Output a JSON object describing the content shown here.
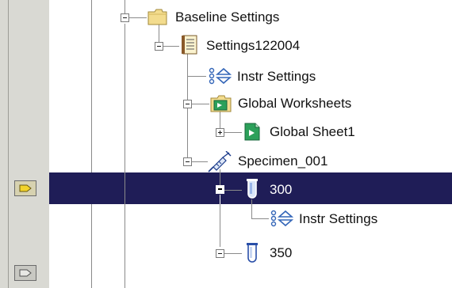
{
  "tree": {
    "nodes": [
      {
        "label": "Baseline Settings",
        "icon": "folder-icon"
      },
      {
        "label": "Settings122004",
        "icon": "notebook-icon"
      },
      {
        "label": "Instr Settings",
        "icon": "instrument-settings-icon"
      },
      {
        "label": "Global Worksheets",
        "icon": "worksheets-folder-icon"
      },
      {
        "label": "Global Sheet1",
        "icon": "worksheet-icon"
      },
      {
        "label": "Specimen_001",
        "icon": "syringe-icon"
      },
      {
        "label": "300",
        "icon": "test-tube-icon",
        "selected": true
      },
      {
        "label": "Instr Settings",
        "icon": "instrument-settings-icon"
      },
      {
        "label": "350",
        "icon": "test-tube-icon"
      }
    ]
  },
  "colors": {
    "selection": "#1f1d57",
    "gutter": "#d9d9d3"
  }
}
